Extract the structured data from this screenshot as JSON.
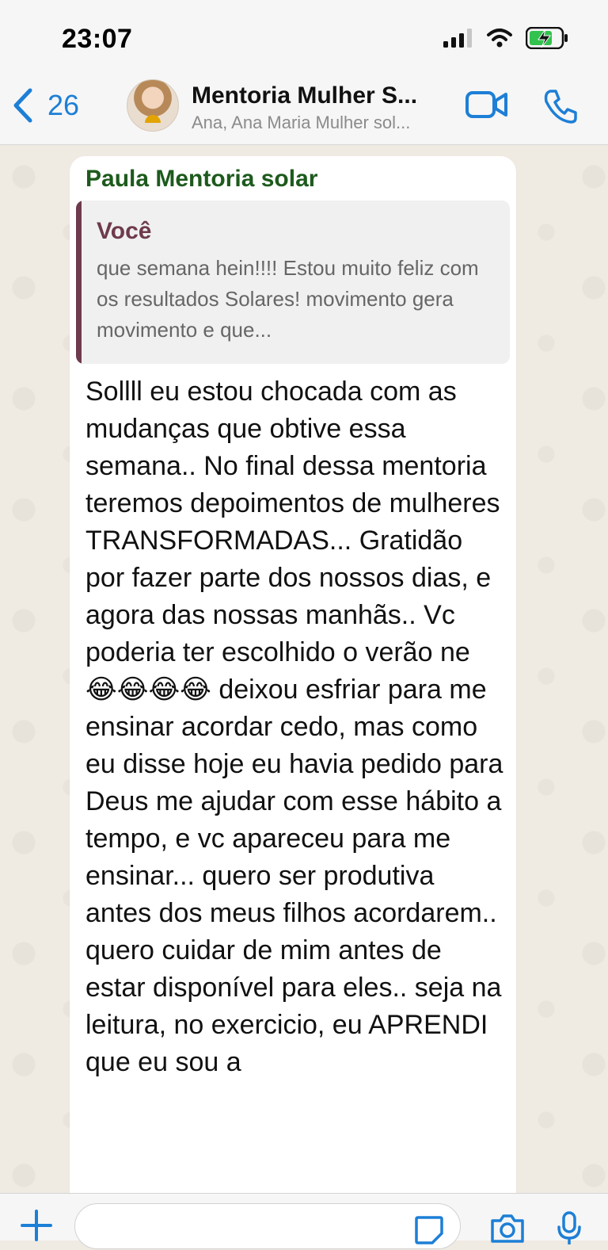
{
  "status": {
    "time": "23:07"
  },
  "header": {
    "back_count": "26",
    "title": "Mentoria Mulher S...",
    "subtitle": "Ana, Ana Maria Mulher sol..."
  },
  "message": {
    "sender": "Paula Mentoria solar",
    "quote": {
      "author": "Você",
      "text": "que semana hein!!!! Estou muito feliz com os resultados Solares! movimento gera movimento e que..."
    },
    "body": "Sollll eu estou chocada com as mudanças que obtive essa semana.. No final dessa mentoria teremos depoimentos de mulheres TRANSFORMADAS... Gratidão por fazer parte dos nossos dias, e agora das nossas manhãs.. Vc poderia ter escolhido o verão ne 😂😂😂😂 deixou esfriar para me ensinar acordar cedo, mas como eu disse hoje eu havia pedido para Deus me ajudar com esse hábito a tempo, e vc apareceu para me ensinar... quero ser produtiva antes dos meus filhos acordarem.. quero cuidar de mim antes de estar disponível para eles.. seja na leitura, no exercicio, eu APRENDI que eu sou a"
  },
  "input": {
    "placeholder": ""
  },
  "colors": {
    "accent": "#1d7fd6",
    "sender": "#1d5a1d",
    "quote_author": "#6e3a4e",
    "chat_bg": "#efeae2"
  }
}
